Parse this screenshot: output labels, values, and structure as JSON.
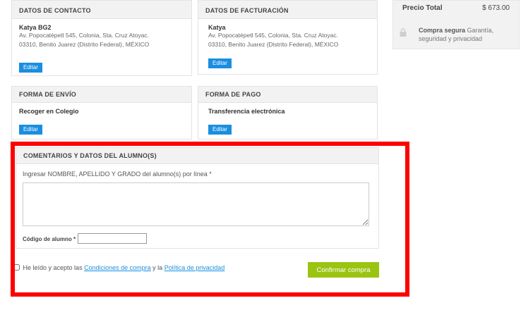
{
  "contact": {
    "heading": "DATOS DE CONTACTO",
    "name": "Katya BG2",
    "address_line1": "Av. Popocatépetl 545, Colonia, Sta. Cruz Atoyac.",
    "address_line2": "03310, Benito Juarez (Distrito Federal), MÉXICO",
    "edit_label": "Editar"
  },
  "billing": {
    "heading": "DATOS DE FACTURACIÓN",
    "name": "Katya",
    "address_line1": "Av. Popocatépetl 545, Colonia, Sta. Cruz Atoyac.",
    "address_line2": "03310, Benito Juarez (Distrito Federal), MÉXICO",
    "edit_label": "Editar"
  },
  "shipping": {
    "heading": "FORMA DE ENVÍO",
    "method": "Recoger en Colegio",
    "edit_label": "Editar"
  },
  "payment": {
    "heading": "FORMA DE PAGO",
    "method": "Transferencia electrónica",
    "edit_label": "Editar"
  },
  "summary": {
    "total_label": "Precio Total",
    "total_value": "$ 673.00",
    "secure_title": "Compra segura",
    "secure_text": "Garantía, seguridad y privacidad",
    "secure_icon": "lock-icon"
  },
  "comments": {
    "heading": "COMENTARIOS Y DATOS DEL ALUMNO(S)",
    "instructions": "Ingresar NOMBRE, APELLIDO Y GRADO del alumno(s) por línea *",
    "textarea_value": "",
    "student_code_label": "Código de alumno *",
    "student_code_value": ""
  },
  "terms": {
    "prefix": "He leído y acepto las",
    "purchase_conditions_link": "Condiciones de compra",
    "connector": "y la",
    "privacy_link": "Política de privacidad",
    "checked": false
  },
  "confirm_button": "Confirmar compra",
  "colors": {
    "accent_blue": "#1a8ee0",
    "confirm_green": "#9bc412",
    "highlight_red": "#ff0000"
  }
}
